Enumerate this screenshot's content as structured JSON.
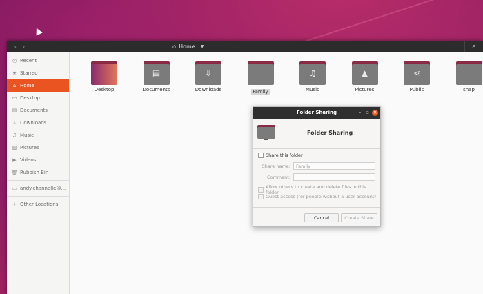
{
  "window": {
    "location": "Home"
  },
  "sidebar": {
    "items": [
      {
        "label": "Recent",
        "icon": "clock-icon",
        "glyph": "◷"
      },
      {
        "label": "Starred",
        "icon": "star-icon",
        "glyph": "★"
      },
      {
        "label": "Home",
        "icon": "home-icon",
        "glyph": "⌂",
        "active": true
      },
      {
        "label": "Desktop",
        "icon": "desktop-icon",
        "glyph": "▭"
      },
      {
        "label": "Documents",
        "icon": "document-icon",
        "glyph": "▤"
      },
      {
        "label": "Downloads",
        "icon": "download-icon",
        "glyph": "⇩"
      },
      {
        "label": "Music",
        "icon": "music-icon",
        "glyph": "♫"
      },
      {
        "label": "Pictures",
        "icon": "picture-icon",
        "glyph": "▨"
      },
      {
        "label": "Videos",
        "icon": "video-icon",
        "glyph": "▶"
      },
      {
        "label": "Rubbish Bin",
        "icon": "trash-icon",
        "glyph": "🗑"
      },
      {
        "label": "andy.channelle@...",
        "icon": "network-drive-icon",
        "glyph": "▭"
      },
      {
        "label": "Other Locations",
        "icon": "plus-icon",
        "glyph": "+"
      }
    ]
  },
  "files": [
    {
      "name": "Desktop",
      "icon": "desktop-folder-icon",
      "glyph": ""
    },
    {
      "name": "Documents",
      "icon": "documents-folder-icon",
      "glyph": "▤"
    },
    {
      "name": "Downloads",
      "icon": "downloads-folder-icon",
      "glyph": "⇩"
    },
    {
      "name": "Family",
      "icon": "folder-icon",
      "glyph": "",
      "selected": true
    },
    {
      "name": "Music",
      "icon": "music-folder-icon",
      "glyph": "♫"
    },
    {
      "name": "Pictures",
      "icon": "pictures-folder-icon",
      "glyph": "▲"
    },
    {
      "name": "Public",
      "icon": "public-folder-icon",
      "glyph": "⋖"
    },
    {
      "name": "snap",
      "icon": "folder-icon",
      "glyph": ""
    }
  ],
  "dialog": {
    "title": "Folder Sharing",
    "heading": "Folder Sharing",
    "share_label": "Share this folder",
    "share_name_label": "Share name:",
    "share_name_value": "Family",
    "comment_label": "Comment:",
    "allow_label": "Allow others to create and delete files in this folder",
    "guest_label": "Guest access (for people without a user account)",
    "cancel": "Cancel",
    "create": "Create Share"
  },
  "colors": {
    "accent": "#e95420",
    "folder_tab": "#8b2a45",
    "folder_body": "#7b7b7b"
  }
}
